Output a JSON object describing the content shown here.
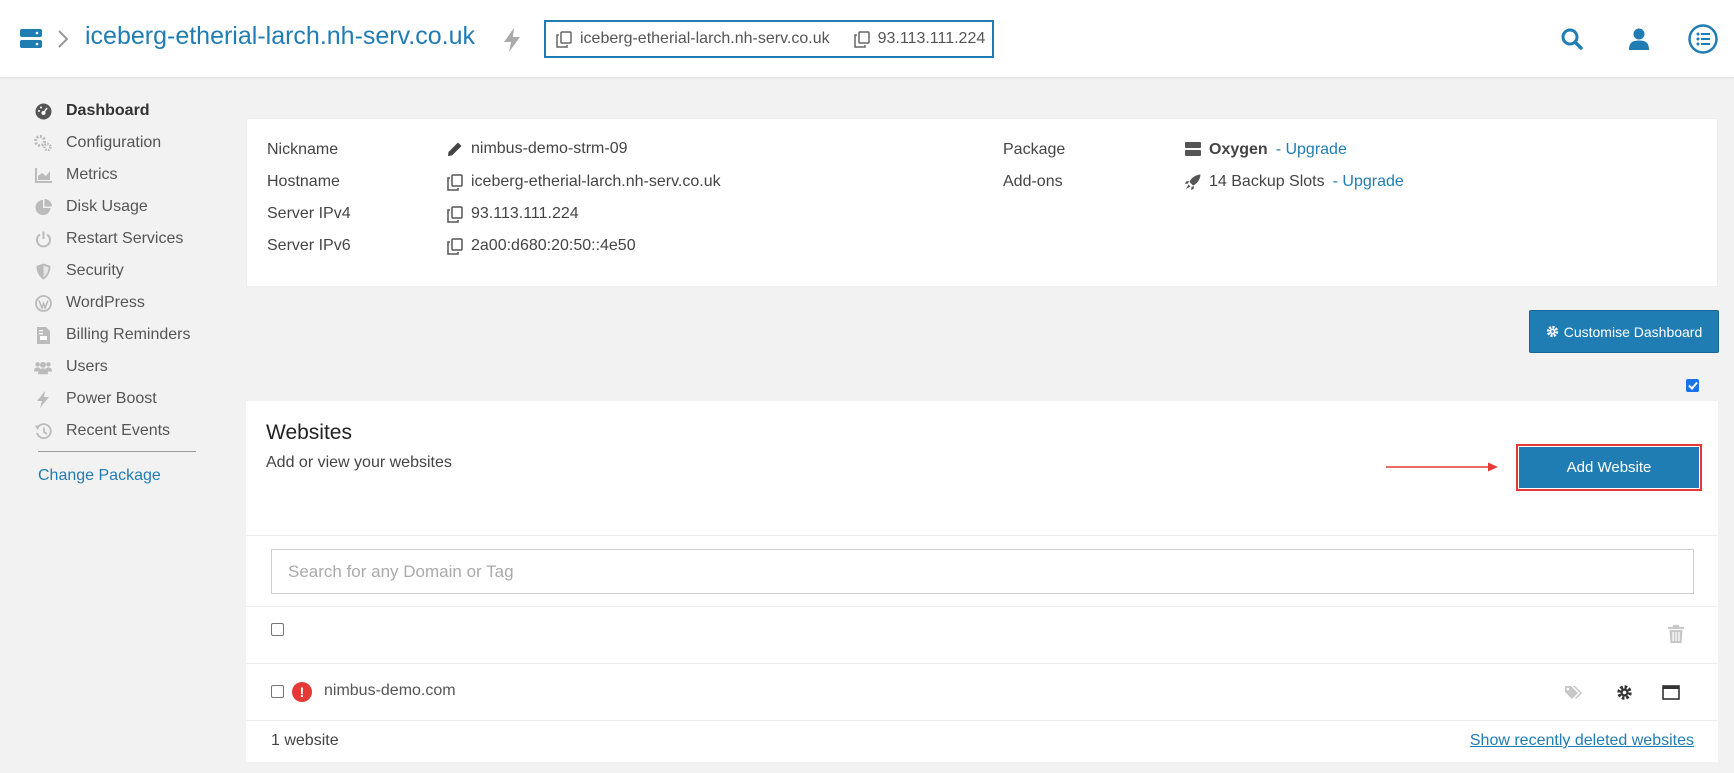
{
  "header": {
    "server_title": "iceberg-etherial-larch.nh-serv.co.uk",
    "hostname": "iceberg-etherial-larch.nh-serv.co.uk",
    "ip": "93.113.111.224",
    "icons": [
      "server-icon",
      "chevron-right-icon",
      "bolt-icon",
      "copy-icon",
      "search-icon",
      "user-icon",
      "list-icon"
    ]
  },
  "sidebar": {
    "items": [
      {
        "label": "Dashboard",
        "icon": "dashboard-icon"
      },
      {
        "label": "Configuration",
        "icon": "cogs-icon"
      },
      {
        "label": "Metrics",
        "icon": "chart-icon"
      },
      {
        "label": "Disk Usage",
        "icon": "pie-icon"
      },
      {
        "label": "Restart Services",
        "icon": "power-icon"
      },
      {
        "label": "Security",
        "icon": "shield-icon"
      },
      {
        "label": "WordPress",
        "icon": "wordpress-icon"
      },
      {
        "label": "Billing Reminders",
        "icon": "invoice-icon"
      },
      {
        "label": "Users",
        "icon": "users-icon"
      },
      {
        "label": "Power Boost",
        "icon": "bolt-icon"
      },
      {
        "label": "Recent Events",
        "icon": "history-icon"
      }
    ],
    "change_package": "Change Package"
  },
  "info": {
    "nickname_label": "Nickname",
    "nickname": "nimbus-demo-strm-09",
    "hostname_label": "Hostname",
    "hostname": "iceberg-etherial-larch.nh-serv.co.uk",
    "ipv4_label": "Server IPv4",
    "ipv4": "93.113.111.224",
    "ipv6_label": "Server IPv6",
    "ipv6": "2a00:d680:20:50::4e50",
    "package_label": "Package",
    "package": "Oxygen",
    "package_upgrade": "- Upgrade",
    "addons_label": "Add-ons",
    "addons": "14 Backup Slots",
    "addons_upgrade": "- Upgrade"
  },
  "customise_button": "Customise Dashboard",
  "websites": {
    "title": "Websites",
    "subtitle": "Add or view your websites",
    "add_button": "Add Website",
    "search_placeholder": "Search for any Domain or Tag",
    "rows": [
      {
        "domain": "nimbus-demo.com",
        "status": "!"
      }
    ],
    "count": "1 website",
    "deleted_link": "Show recently deleted websites"
  },
  "colors": {
    "accent": "#1f7db4",
    "highlight": "#e53935",
    "background": "#f2f2f2"
  }
}
